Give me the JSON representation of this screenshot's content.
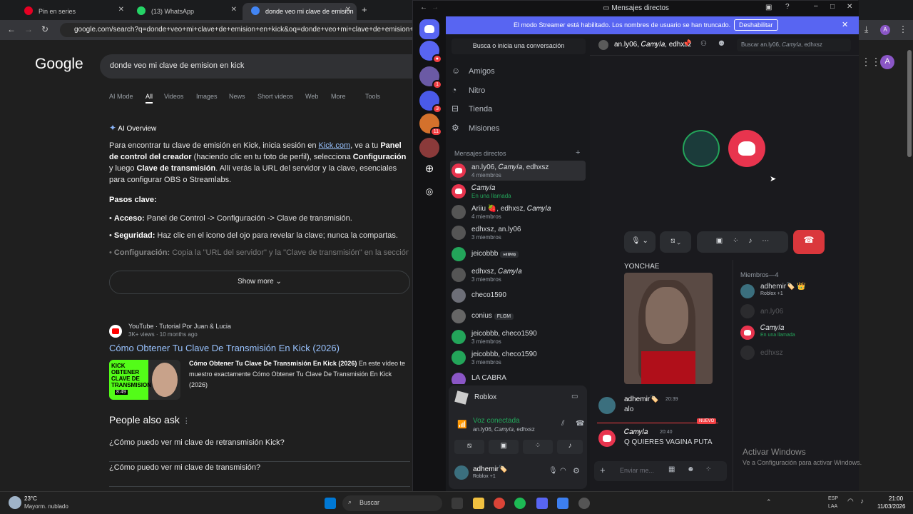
{
  "browser": {
    "tabs": [
      "Pin en series",
      "(13) WhatsApp",
      "donde veo mi clave de emision"
    ],
    "url": "google.com/search?q=donde+veo+mi+clave+de+emision+en+kick&oq=donde+veo+mi+clave+de+emision+en+"
  },
  "google": {
    "logo": "Google",
    "query": "donde veo mi clave de emision en kick",
    "filters": [
      "AI Mode",
      "All",
      "Videos",
      "Images",
      "News",
      "Short videos",
      "Web",
      "More",
      "Tools"
    ],
    "ai_title": "AI Overview",
    "p1_a": "Para encontrar tu clave de emisión en Kick, inicia sesión en ",
    "p1_link": "Kick.com",
    "p1_b": ", ve a tu ",
    "p1_bold1": "Panel de control del creador",
    "p1_c": " (haciendo clic en tu foto de perfil), selecciona ",
    "p1_bold2": "Configuración",
    "p1_d": " y luego ",
    "p1_bold3": "Clave de transmisión",
    "p1_e": ". Allí verás la URL del servidor y la clave, esenciales para configurar OBS o Streamlabs.",
    "steps_title": "Pasos clave:",
    "step1_label": "Acceso:",
    "step1_text": " Panel de Control -> Configuración -> Clave de transmisión.",
    "step2_label": "Seguridad:",
    "step2_text": " Haz clic en el icono del ojo para revelar la clave; nunca la compartas.",
    "step3_label": "Configuración:",
    "step3_text": " Copia la \"URL del servidor\" y la \"Clave de transmisión\" en la sección",
    "show_more": "Show more",
    "yt_source": "YouTube · Tutorial Por Juan & Lucia",
    "yt_meta": "3K+ views · 10 months ago",
    "yt_title": "Cómo Obtener Tu Clave De Transmisión En Kick (2026)",
    "yt_snip_bold": "Cómo Obtener Tu Clave De Transmisión En Kick (2026)",
    "yt_snip": " En este vídeo te muestro exactamente Cómo Obtener Tu Clave De Transmisión En Kick (2026)",
    "yt_thumb": "KICK OBTENER CLAVE DE TRANSMISION",
    "yt_time": "8:49",
    "paa_title": "People also ask",
    "paa": [
      "¿Cómo puedo ver mi clave de retransmisión Kick?",
      "¿Cómo puedo ver mi clave de transmisión?"
    ]
  },
  "discord": {
    "title": "Mensajes directos",
    "streamer_text": "El modo Streamer está habilitado. Los nombres de usuario se han truncado.",
    "streamer_btn": "Deshabilitar",
    "search_dm": "Busca o inicia una conversación",
    "nav": [
      "Amigos",
      "Nitro",
      "Tienda",
      "Misiones"
    ],
    "dm_header": "Mensajes directos",
    "dms": [
      {
        "name": "an.ly06, 𝐶𝑎𝑚𝑦𝑙𝑎, edhxsz",
        "sub": "4 miembros"
      },
      {
        "name": "𝐶𝑎𝑚𝑦𝑙𝑎",
        "sub": "En una llamada"
      },
      {
        "name": "Ariiu 🍓, edhxsz, 𝐶𝑎𝑚𝑦𝑙𝑎",
        "sub": "4 miembros"
      },
      {
        "name": "edhxsz, an.ly06",
        "sub": "3 miembros"
      },
      {
        "name": "jeicobbb",
        "sub": "",
        "tag": "𝖘𝖆𝖜𝖆𝖞"
      },
      {
        "name": "edhxsz, 𝐶𝑎𝑚𝑦𝑙𝑎",
        "sub": "3 miembros"
      },
      {
        "name": "checo1590",
        "sub": ""
      },
      {
        "name": "conius",
        "sub": "",
        "tag": "FLGM"
      },
      {
        "name": "jeicobbb, checo1590",
        "sub": "3 miembros"
      },
      {
        "name": "jeicobbb, checo1590",
        "sub": "3 miembros"
      },
      {
        "name": "LA CABRA",
        "sub": ""
      }
    ],
    "game": "Roblox",
    "voice_status": "Voz conectada",
    "voice_members": "an.ly06, 𝐶𝑎𝑚𝑦𝑙𝑎, edhxsz",
    "user_name": "adhemir🏷️",
    "user_status": "Roblox +1",
    "channel_name": "an.ly06, 𝐶𝑎𝑚𝑦𝑙𝑎, edhxsz",
    "search_placeholder": "Buscar an.ly06, 𝐶𝑎𝑚𝑦𝑙𝑎, edhxsz",
    "image_caption": "YONCHAE",
    "messages": [
      {
        "author": "adhemir🏷️",
        "time": "20:39",
        "text": "alo"
      },
      {
        "author": "𝐶𝑎𝑚𝑦𝑙𝑎",
        "time": "20:40",
        "text": "Q QUIERES VAGINA PUTA"
      }
    ],
    "new_label": "NUEVO",
    "composer_placeholder": "Enviar me...",
    "members_title": "Miembros—4",
    "members": [
      {
        "name": "adhemir🏷️ 👑",
        "sub": "Roblox +1"
      },
      {
        "name": "an.ly06",
        "sub": ""
      },
      {
        "name": "𝐶𝑎𝑚𝑦𝑙𝑎",
        "sub": "En una llamada"
      },
      {
        "name": "edhxsz",
        "sub": ""
      }
    ],
    "activate_title": "Activar Windows",
    "activate_sub": "Ve a Configuración para activar Windows."
  },
  "taskbar": {
    "temp": "23°C",
    "weather": "Mayorm. nublado",
    "search": "Buscar",
    "lang": "ESP",
    "lang2": "LAA",
    "time": "21:00",
    "date": "11/03/2026"
  },
  "colors": {
    "discord_blurple": "#5865f2",
    "danger": "#da373c",
    "voice_green": "#23a55a",
    "link": "#99c3ff"
  }
}
